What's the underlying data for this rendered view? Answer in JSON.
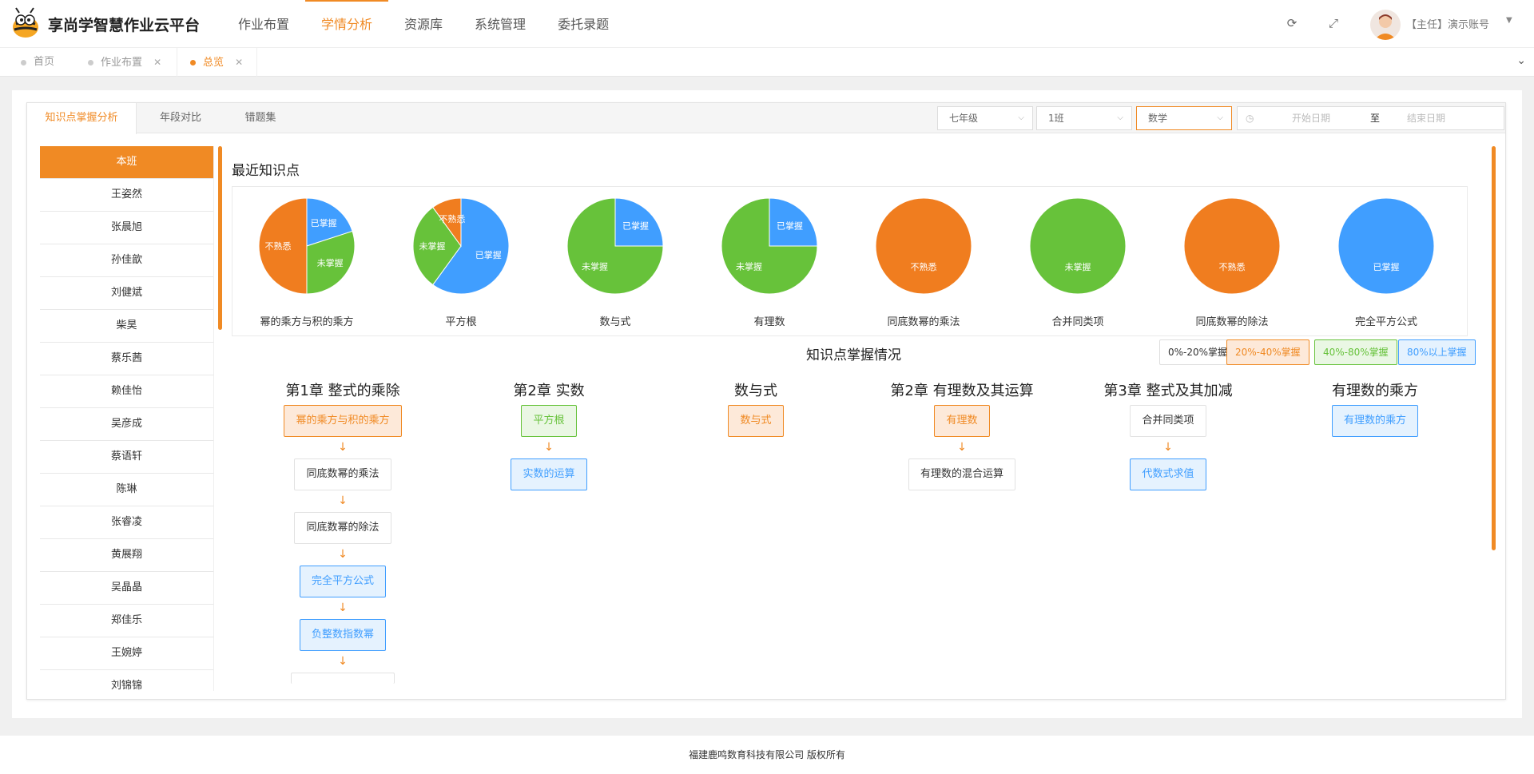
{
  "app": {
    "brand": "享尚学智慧作业云平台"
  },
  "topnav": [
    {
      "label": "作业布置",
      "active": false
    },
    {
      "label": "学情分析",
      "active": true
    },
    {
      "label": "资源库",
      "active": false
    },
    {
      "label": "系统管理",
      "active": false
    },
    {
      "label": "委托录题",
      "active": false
    }
  ],
  "user": {
    "label": "【主任】演示账号"
  },
  "pagetabs": [
    {
      "label": "首页",
      "closable": false,
      "active": false
    },
    {
      "label": "作业布置",
      "closable": true,
      "active": false
    },
    {
      "label": "总览",
      "closable": true,
      "active": true
    }
  ],
  "subtabs": [
    {
      "label": "知识点掌握分析",
      "active": true
    },
    {
      "label": "年段对比",
      "active": false
    },
    {
      "label": "错题集",
      "active": false
    }
  ],
  "filters": {
    "grade": "七年级",
    "class": "1班",
    "subject": "数学",
    "start_placeholder": "开始日期",
    "separator": "至",
    "end_placeholder": "结束日期"
  },
  "students": [
    "本班",
    "王姿然",
    "张晨旭",
    "孙佳歆",
    "刘健斌",
    "柴昊",
    "蔡乐茜",
    "赖佳怡",
    "吴彦成",
    "蔡语轩",
    "陈琳",
    "张睿凌",
    "黄展翔",
    "吴晶晶",
    "郑佳乐",
    "王婉婷",
    "刘锦锦"
  ],
  "recent": {
    "title": "最近知识点",
    "colors": {
      "mastered": "#409eff",
      "unmastered": "#67c23a",
      "unfamiliar": "#f07d1f"
    },
    "labels": {
      "mastered": "已掌握",
      "unmastered": "未掌握",
      "unfamiliar": "不熟悉"
    },
    "pies": [
      {
        "name": "幂的乘方与积的乘方",
        "slices": [
          {
            "k": "mastered",
            "v": 0.2
          },
          {
            "k": "unmastered",
            "v": 0.3
          },
          {
            "k": "unfamiliar",
            "v": 0.5
          }
        ]
      },
      {
        "name": "平方根",
        "slices": [
          {
            "k": "mastered",
            "v": 0.6
          },
          {
            "k": "unmastered",
            "v": 0.3
          },
          {
            "k": "unfamiliar",
            "v": 0.1
          }
        ]
      },
      {
        "name": "数与式",
        "slices": [
          {
            "k": "mastered",
            "v": 0.25
          },
          {
            "k": "unmastered",
            "v": 0.75
          }
        ]
      },
      {
        "name": "有理数",
        "slices": [
          {
            "k": "mastered",
            "v": 0.25
          },
          {
            "k": "unmastered",
            "v": 0.75
          }
        ]
      },
      {
        "name": "同底数幂的乘法",
        "slices": [
          {
            "k": "unfamiliar",
            "v": 1
          }
        ]
      },
      {
        "name": "合并同类项",
        "slices": [
          {
            "k": "unmastered",
            "v": 1
          }
        ]
      },
      {
        "name": "同底数幂的除法",
        "slices": [
          {
            "k": "unfamiliar",
            "v": 1
          }
        ]
      },
      {
        "name": "完全平方公式",
        "slices": [
          {
            "k": "mastered",
            "v": 1
          }
        ]
      }
    ]
  },
  "mastery": {
    "title": "知识点掌握情况",
    "legend": [
      {
        "label": "0%-20%掌握",
        "color": "#333333",
        "border": "#dddddd",
        "bg": "#ffffff"
      },
      {
        "label": "20%-40%掌握",
        "color": "#f08a24",
        "border": "#f08a24",
        "bg": "#fde9d9"
      },
      {
        "label": "40%-80%掌握",
        "color": "#66c23a",
        "border": "#66c23a",
        "bg": "#eaf7e4"
      },
      {
        "label": "80%以上掌握",
        "color": "#409eff",
        "border": "#409eff",
        "bg": "#e5f2fe"
      }
    ],
    "chapters": [
      {
        "title": "第1章 整式的乘除",
        "items": [
          {
            "label": "幂的乘方与积的乘方",
            "level": "orange"
          },
          {
            "label": "同底数幂的乘法",
            "level": "plain"
          },
          {
            "label": "同底数幂的除法",
            "level": "plain"
          },
          {
            "label": "完全平方公式",
            "level": "blue"
          },
          {
            "label": "负整数指数幂",
            "level": "blue"
          },
          {
            "label": "",
            "level": "plain"
          }
        ]
      },
      {
        "title": "第2章 实数",
        "items": [
          {
            "label": "平方根",
            "level": "green"
          },
          {
            "label": "实数的运算",
            "level": "blue"
          }
        ]
      },
      {
        "title": "数与式",
        "items": [
          {
            "label": "数与式",
            "level": "orange"
          }
        ]
      },
      {
        "title": "第2章 有理数及其运算",
        "items": [
          {
            "label": "有理数",
            "level": "orange"
          },
          {
            "label": "有理数的混合运算",
            "level": "plain"
          }
        ]
      },
      {
        "title": "第3章 整式及其加减",
        "items": [
          {
            "label": "合并同类项",
            "level": "plain"
          },
          {
            "label": "代数式求值",
            "level": "blue"
          }
        ]
      },
      {
        "title": "有理数的乘方",
        "items": [
          {
            "label": "有理数的乘方",
            "level": "blue"
          }
        ]
      }
    ]
  },
  "footer": "福建鹿鸣数育科技有限公司 版权所有"
}
